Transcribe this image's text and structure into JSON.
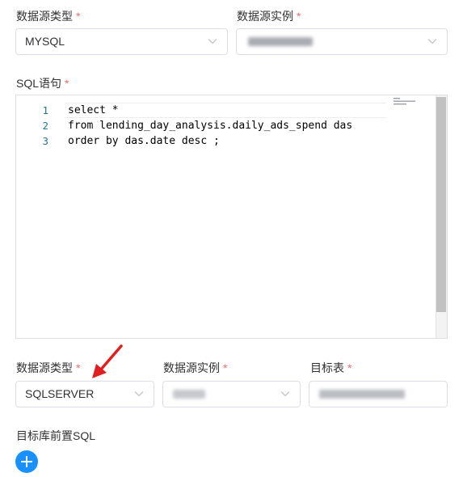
{
  "top_row": {
    "datasource_type_label": "数据源类型",
    "datasource_type_value": "MYSQL",
    "datasource_instance_label": "数据源实例"
  },
  "required_mark": "*",
  "sql": {
    "label": "SQL语句",
    "lines": [
      {
        "num": "1",
        "text": "select *"
      },
      {
        "num": "2",
        "text": "from lending_day_analysis.daily_ads_spend das"
      },
      {
        "num": "3",
        "text": "order by das.date desc ;"
      }
    ]
  },
  "bottom_row": {
    "datasource_type_label": "数据源类型",
    "datasource_type_value": "SQLSERVER",
    "datasource_instance_label": "数据源实例",
    "target_table_label": "目标表"
  },
  "pre_sql": {
    "label": "目标库前置SQL"
  },
  "icons": {
    "chevron": "chevron-down-icon",
    "add": "plus-icon",
    "annotation": "red-arrow-icon"
  },
  "colors": {
    "accent": "#1890ff",
    "required": "#f56c6c",
    "annotation_arrow": "#e02020"
  }
}
